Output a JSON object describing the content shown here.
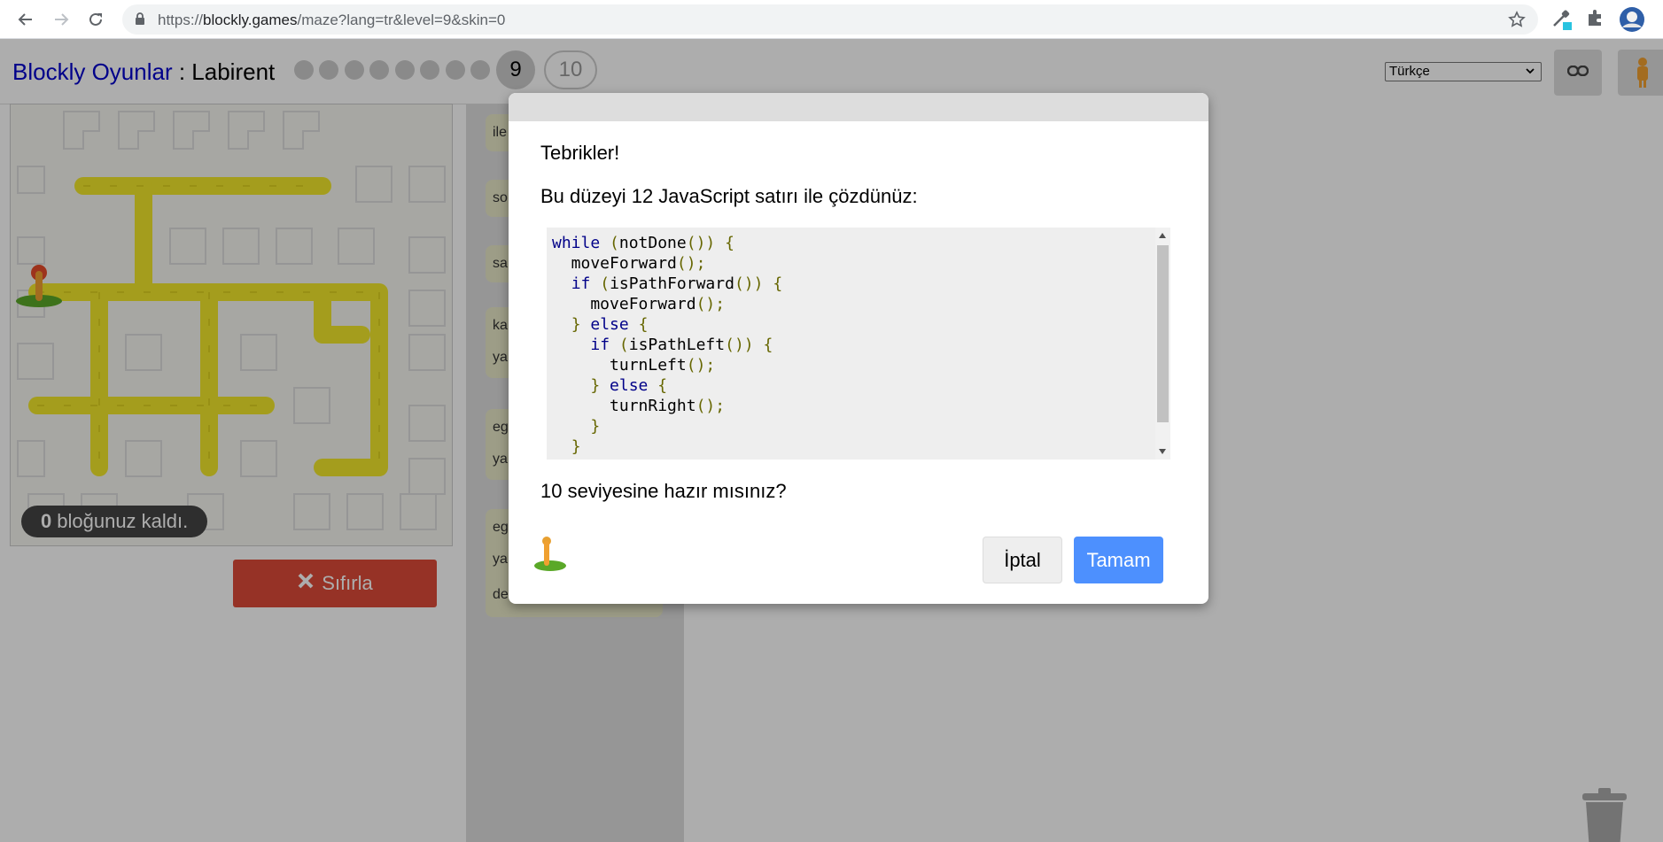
{
  "browser": {
    "url_scheme": "https://",
    "url_host": "blockly.games",
    "url_path": "/maze?lang=tr&level=9&skin=0",
    "icons": [
      "back-icon",
      "forward-icon",
      "reload-icon",
      "lock-icon",
      "star-icon",
      "eyedropper-extension-icon",
      "puzzle-extension-icon",
      "profile-avatar"
    ]
  },
  "header": {
    "games_link": "Blockly Oyunlar",
    "separator": " : ",
    "game_title": "Labirent",
    "levels": [
      "1",
      "2",
      "3",
      "4",
      "5",
      "6",
      "7",
      "8",
      "9",
      "10"
    ],
    "current_level": "9",
    "next_level": "10",
    "language": "Türkçe"
  },
  "maze": {
    "blocks_left_count": "0",
    "blocks_left_text": "bloğunuz kaldı.",
    "reset_label": "Sıfırla"
  },
  "toolbox_fragments": [
    "ile",
    "so",
    "sa",
    "ka",
    "ya",
    "eg",
    "ya",
    "eg",
    "ya",
    "de"
  ],
  "dialog": {
    "heading": "Tebrikler!",
    "solved_message": "Bu düzeyi 12 JavaScript satırı ile çözdünüz:",
    "code_lines": [
      "while (notDone()) {",
      "  moveForward();",
      "  if (isPathForward()) {",
      "    moveForward();",
      "  } else {",
      "    if (isPathLeft()) {",
      "      turnLeft();",
      "    } else {",
      "      turnRight();",
      "    }",
      "  }"
    ],
    "ready_question": "10 seviyesine hazır mısınız?",
    "cancel_label": "İptal",
    "ok_label": "Tamam"
  },
  "colors": {
    "link_blue": "#0000cc",
    "reset_red": "#dd4b39",
    "ok_blue": "#4d90fe",
    "path_yellow": "#f2e82b",
    "keyword": "#000088",
    "punctuation": "#666600"
  }
}
